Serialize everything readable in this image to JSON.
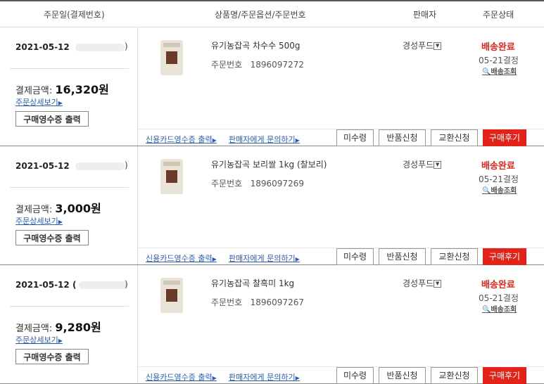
{
  "header": {
    "order_date": "주문일(결제번호)",
    "product": "상품명/주문옵션/주문번호",
    "seller": "판매자",
    "status": "주문상태"
  },
  "orders": [
    {
      "date": "2021-05-12",
      "amount_label": "결제금액:",
      "amount": "16,320",
      "won": "원",
      "detail": "주문상세보기",
      "receipt": "구매영수증 출력",
      "product": "유기농잡곡 차수수 500g",
      "order_no_label": "주문번호",
      "order_no": "1896097272",
      "seller": "경성푸드",
      "status": "배송완료",
      "status_date": "05-21결정",
      "track": "배송조회",
      "card": "신용카드영수증 출력",
      "ask": "판매자에게 문의하기",
      "btn_unreceived": "미수령",
      "btn_return": "반품신청",
      "btn_exchange": "교환신청",
      "btn_review": "구매후기"
    },
    {
      "date": "2021-05-12",
      "amount_label": "결제금액:",
      "amount": "3,000",
      "won": "원",
      "detail": "주문상세보기",
      "receipt": "구매영수증 출력",
      "product": "유기농잡곡 보리쌀 1kg (찰보리)",
      "order_no_label": "주문번호",
      "order_no": "1896097269",
      "seller": "경성푸드",
      "status": "배송완료",
      "status_date": "05-21결정",
      "track": "배송조회",
      "card": "신용카드영수증 출력",
      "ask": "판매자에게 문의하기",
      "btn_unreceived": "미수령",
      "btn_return": "반품신청",
      "btn_exchange": "교환신청",
      "btn_review": "구매후기"
    },
    {
      "date": "2021-05-12",
      "amount_label": "결제금액:",
      "amount": "9,280",
      "won": "원",
      "detail": "주문상세보기",
      "receipt": "구매영수증 출력",
      "product": "유기농잡곡 찰흑미 1kg",
      "order_no_label": "주문번호",
      "order_no": "1896097267",
      "seller": "경성푸드",
      "status": "배송완료",
      "status_date": "05-21결정",
      "track": "배송조회",
      "card": "신용카드영수증 출력",
      "ask": "판매자에게 문의하기",
      "btn_unreceived": "미수령",
      "btn_return": "반품신청",
      "btn_exchange": "교환신청",
      "btn_review": "구매후기"
    }
  ],
  "colors": {
    "accent": "#e3231a",
    "link": "#2a5db0"
  }
}
